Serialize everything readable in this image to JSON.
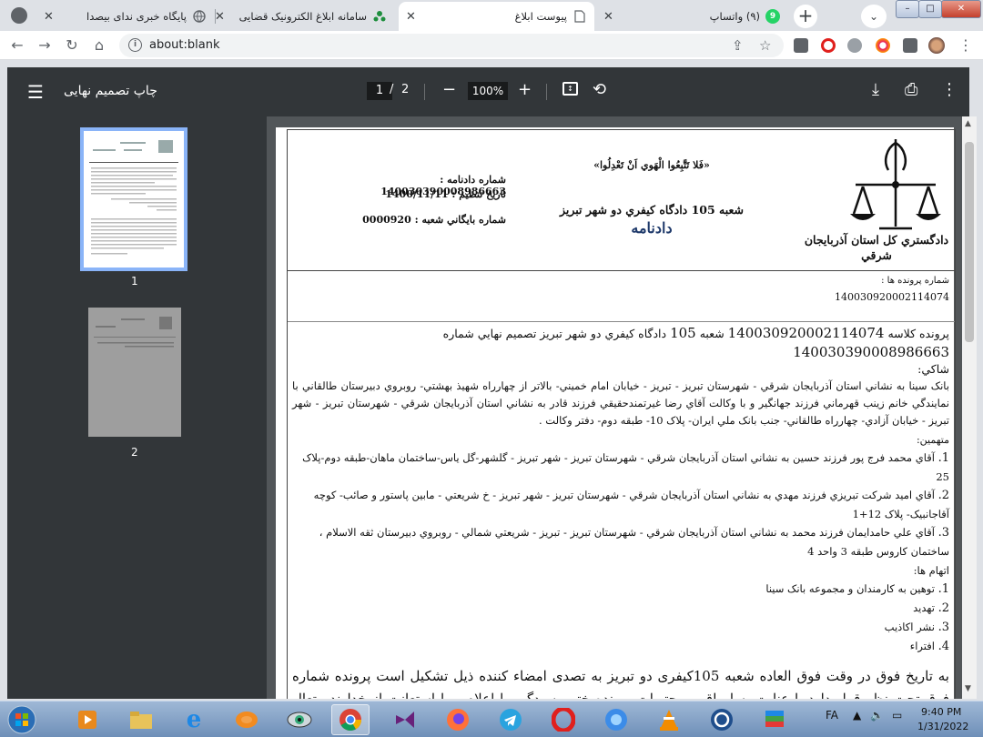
{
  "browser": {
    "tabs": [
      {
        "title": "پایگاه خبری ندای بیصدا",
        "icon": "globe-icon"
      },
      {
        "title": "سامانه ابلاغ الکترونیک قضایی",
        "icon": "tree-logo-icon"
      },
      {
        "title": "پیوست ابلاغ",
        "icon": "document-icon"
      },
      {
        "title": "(۹) واتساپ",
        "icon": "whatsapp-icon",
        "badge": "9"
      }
    ],
    "tab_close": "✕",
    "url": "about:blank"
  },
  "pdf": {
    "title": "چاپ تصمیم نهایی",
    "current_page": "1",
    "page_separator": "/",
    "total_pages": "2",
    "zoom": "100%",
    "thumbnails": [
      "1",
      "2"
    ]
  },
  "document": {
    "motto": "«فَلا تَتَّبِعُوا الْهَوي اَنْ تَعْدِلُوا»",
    "branch": "شعبه 105 دادگاه کيفري دو شهر تبريز",
    "doc_type": "دادنامه",
    "court": "دادگستري کل استان آذربايجان شرقي",
    "fields": [
      {
        "label": "شماره دادنامه :",
        "value": "140030390008986663"
      },
      {
        "label": "تاريخ تنظيم :",
        "value": "1400/11/11"
      },
      {
        "label": "شماره بايگاني شعبه :",
        "value": "0000920"
      }
    ],
    "case_numbers_label": "شماره پرونده ها :",
    "case_numbers_value": "140030920002114074",
    "case_line_prefix": "پرونده کلاسه",
    "case_line_num": "140030920002114074",
    "case_line_mid": "شعبه",
    "case_line_branch": "105",
    "case_line_rest": "دادگاه کيفري دو شهر تبريز تصميم نهايي شماره",
    "case_line_num2": "140030390008986663",
    "complainant_label": "شاکي:",
    "complainant_text": "بانک سينا به نشاني استان آذربايجان شرقي - شهرستان تبريز - تبريز - خيابان امام خميني- بالاتر از چهارراه شهيذ بهشتي- روبروي دبيرستان طالقاني با نمايندگي خانم زينب قهرماني فرزند جهانگير و با وکالت آقاي رضا غيرتمندحقيقي فرزند قادر به نشاني استان آذربايجان شرقي - شهرستان تبريز - شهر تبريز - خيابان آزادي- چهارراه طالقاني- جنب بانک ملي ايران- پلاک 10- طبقه دوم- دفتر وکالت .",
    "accused_label": "متهمين:",
    "accused": [
      {
        "num": "1.",
        "text": "آقاي محمد فرج پور فرزند حسين به نشاني استان آذربايجان شرقي - شهرستان تبريز - شهر تبريز - گلشهر-گل ياس-ساختمان ماهان-طبقه دوم-پلاک 25"
      },
      {
        "num": "2.",
        "text": "آقاي اميد شرکت تبريزي فرزند مهدي به نشاني استان آذربايجان شرقي - شهرستان تبريز - شهر تبريز - خ شريعتي - مابين پاستور و صائب- کوچه آقاجانبيک- پلاک 12+1"
      },
      {
        "num": "3.",
        "text": "آقاي علي حامدايمان فرزند محمد به نشاني استان آذربايجان شرقي - شهرستان تبريز - تبريز - شريعتي شمالي - روبروي دبيرستان ثقه الاسلام ، ساختمان کاروس طبقه 3 واحد 4"
      }
    ],
    "charges_label": "اتهام ها:",
    "charges": [
      {
        "num": "1.",
        "text": "توهين به کارمندان و مجموعه بانک سينا"
      },
      {
        "num": "2.",
        "text": "تهديد"
      },
      {
        "num": "3.",
        "text": "نشر اکاذيب"
      },
      {
        "num": "4.",
        "text": "افتراء"
      }
    ],
    "body_text": "به تاریخ فوق در وقت فوق العاده شعبه 105کیفری دو تبریز به تصدی امضاء کننده ذیل تشکیل است پرونده شماره فوق تحت نظر قرار دارد با عنایت به اوراق و محتویات پرونده ختم رسیدگی را اعلام و با استعانت از خداوند متعال بشرح آتی"
  },
  "taskbar": {
    "lang": "FA",
    "time": "9:40 PM",
    "date": "1/31/2022",
    "apps": [
      "start-orb-icon",
      "media-player-icon",
      "file-explorer-icon",
      "internet-explorer-icon",
      "paint-app-icon",
      "eye-app-icon",
      "chrome-icon",
      "visual-studio-icon",
      "firefox-icon",
      "telegram-icon",
      "opera-icon",
      "edge-icon",
      "vlc-icon",
      "sync-app-icon",
      "stack-app-icon"
    ]
  }
}
